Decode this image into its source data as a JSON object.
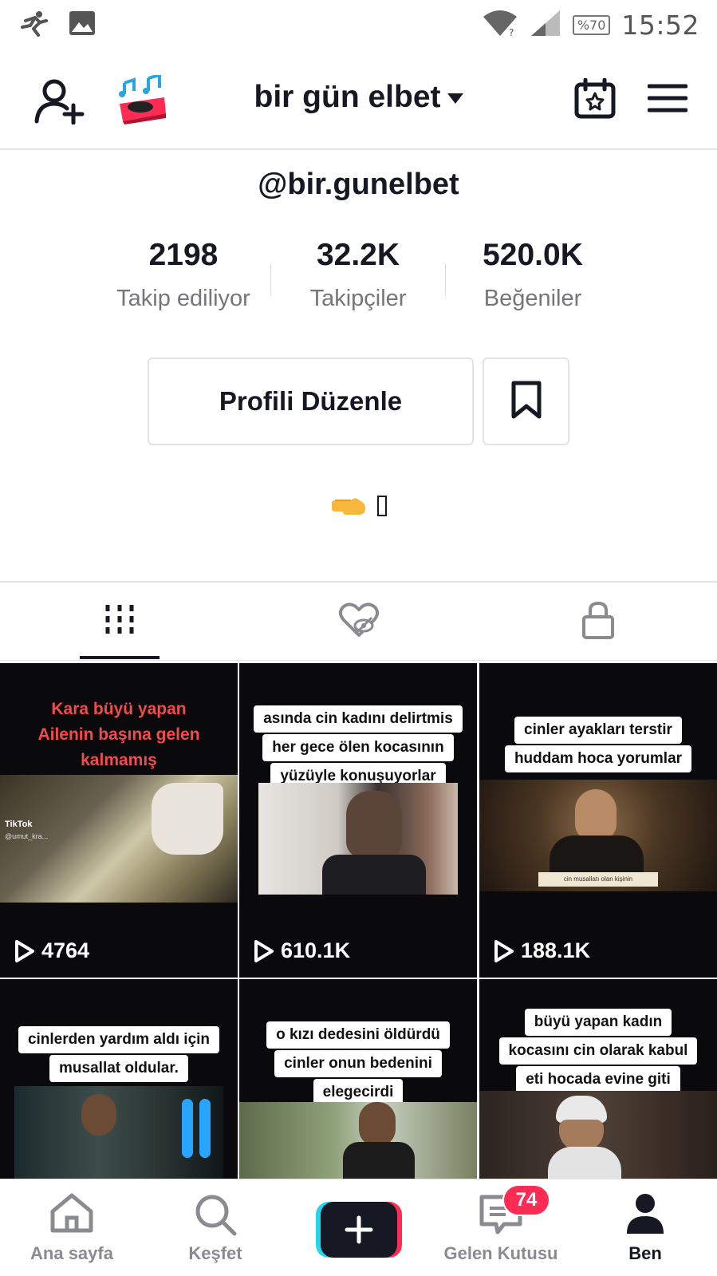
{
  "status_bar": {
    "battery": "%70",
    "time": "15:52"
  },
  "header": {
    "title": "bir gün elbet"
  },
  "profile": {
    "handle": "@bir.gunelbet",
    "stats": [
      {
        "value": "2198",
        "label": "Takip ediliyor"
      },
      {
        "value": "32.2K",
        "label": "Takipçiler"
      },
      {
        "value": "520.0K",
        "label": "Beğeniler"
      }
    ],
    "edit_label": "Profili Düzenle",
    "bio": "👈🏻"
  },
  "videos": [
    {
      "caption": [
        "Kara büyü yapan",
        "Ailenin başına gelen",
        "kalmamış"
      ],
      "views": "4764"
    },
    {
      "caption": [
        "asında cin kadını delirtmis",
        "her gece ölen kocasının",
        "yüzüyle konuşuyorlar"
      ],
      "views": "610.1K"
    },
    {
      "caption": [
        "cinler ayakları terstir",
        "huddam hoca yorumlar"
      ],
      "views": "188.1K"
    },
    {
      "caption": [
        "cinlerden yardım aldı için",
        "musallat oldular."
      ],
      "views": ""
    },
    {
      "caption": [
        "o kızı dedesini öldürdü",
        "cinler onun bedenini",
        "elegecirdi"
      ],
      "views": ""
    },
    {
      "caption": [
        "büyü yapan kadın",
        "kocasını cin olarak kabul",
        "eti hocada evine giti"
      ],
      "views": ""
    }
  ],
  "thumb_texts": {
    "tiktok_watermark": "TikTok",
    "tiktok_user": "@umut_kra...",
    "subtitle_3": "cin musallatı olan kişinin"
  },
  "bottom_nav": {
    "home": "Ana sayfa",
    "discover": "Keşfet",
    "inbox": "Gelen Kutusu",
    "inbox_badge": "74",
    "me": "Ben"
  },
  "colors": {
    "accent_red": "#fe2c55",
    "accent_cyan": "#20d5ec",
    "text_dark": "#161823",
    "text_gray": "#75757a"
  }
}
